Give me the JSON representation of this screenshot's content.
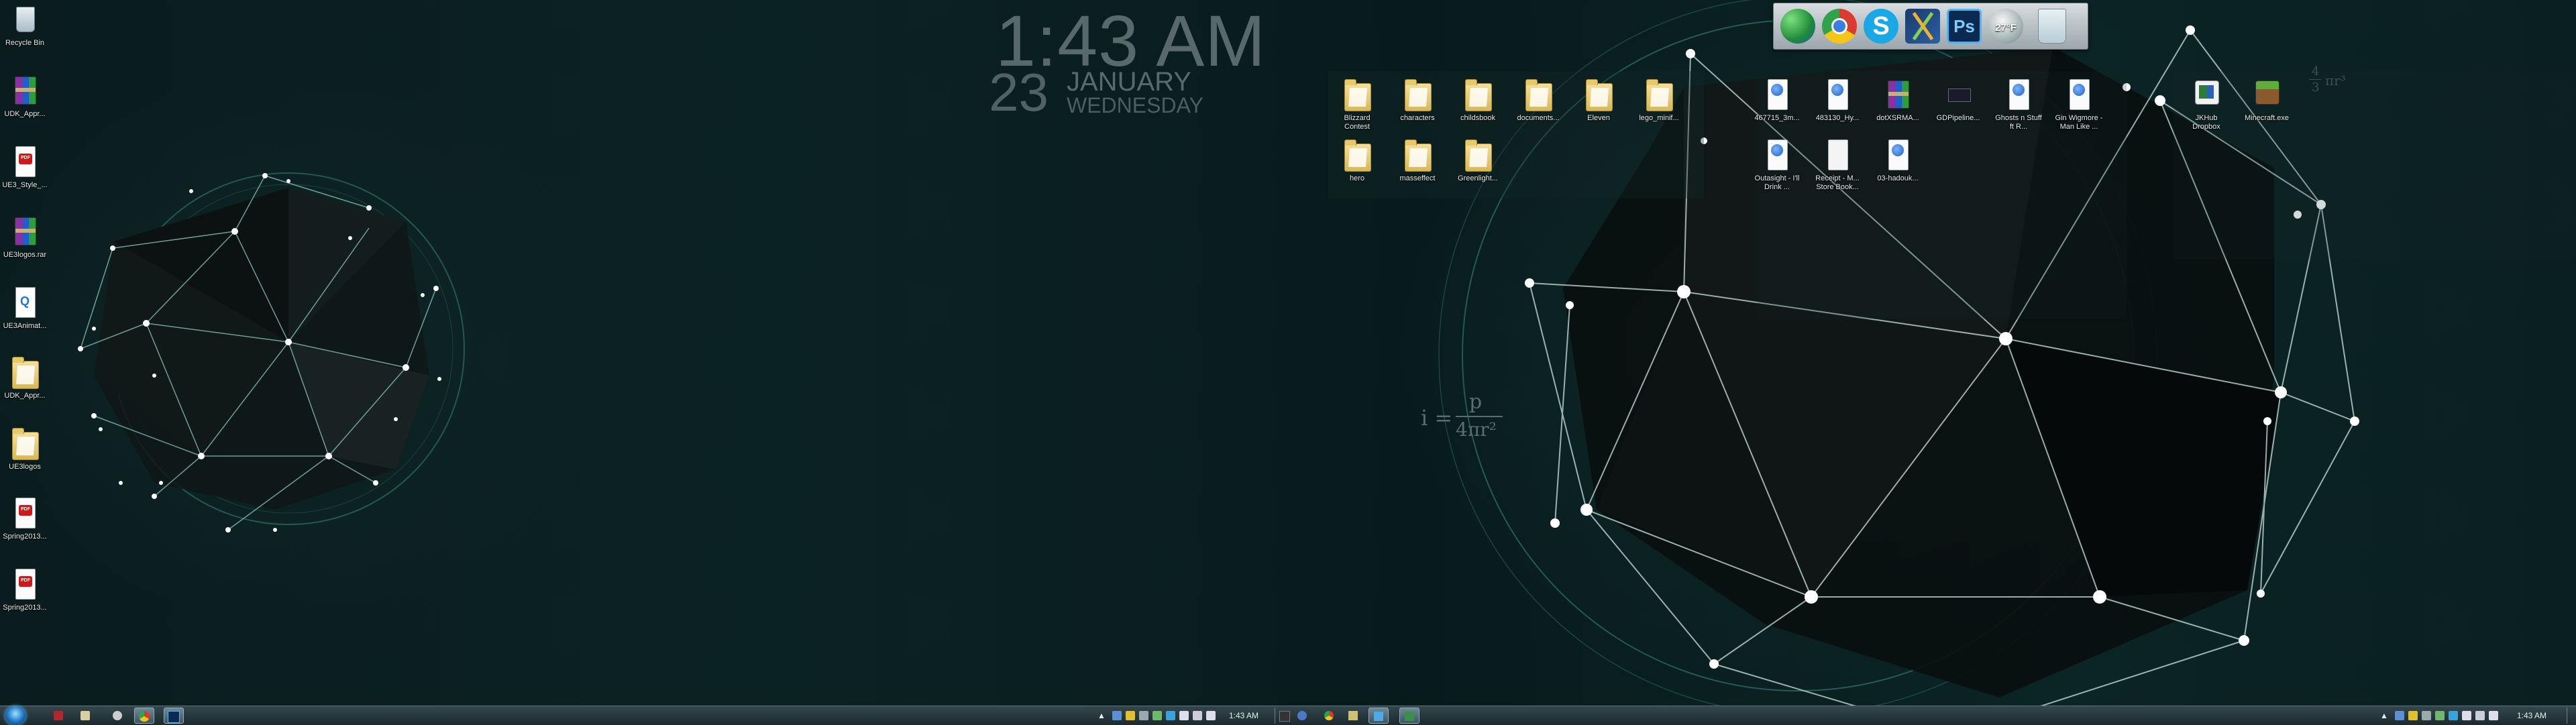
{
  "clock": {
    "time": "1:43 AM",
    "day": "23",
    "month": "JANUARY",
    "weekday": "WEDNESDAY"
  },
  "formula": {
    "lhs": "i =",
    "numerator": "p",
    "denominator": "4πr²"
  },
  "formula_small": {
    "lhs": "",
    "numerator": "4",
    "denominator": "3",
    "tail": "πr³"
  },
  "left_desktop_icons": [
    {
      "label": "Recycle Bin",
      "icon": "recycle-bin-icon"
    },
    {
      "label": "UDK_Appr...",
      "icon": "rar-archive-icon"
    },
    {
      "label": "UE3_Style_...",
      "icon": "pdf-icon"
    },
    {
      "label": "UE3logos.rar",
      "icon": "rar-archive-icon"
    },
    {
      "label": "UE3Animat...",
      "icon": "quicktime-file-icon"
    },
    {
      "label": "UDK_Appr...",
      "icon": "folder-icon"
    },
    {
      "label": "UE3logos",
      "icon": "folder-icon"
    },
    {
      "label": "Spring2013...",
      "icon": "pdf-icon"
    },
    {
      "label": "Spring2013...",
      "icon": "pdf-icon"
    }
  ],
  "right_desktop_icons": [
    {
      "label": "Blizzard Contest",
      "icon": "folder-icon"
    },
    {
      "label": "characters",
      "icon": "folder-icon"
    },
    {
      "label": "childsbook",
      "icon": "folder-icon"
    },
    {
      "label": "documents...",
      "icon": "folder-icon"
    },
    {
      "label": "Eleven",
      "icon": "folder-icon"
    },
    {
      "label": "lego_minif...",
      "icon": "folder-icon"
    },
    {
      "label": "467715_3m...",
      "icon": "web-document-icon"
    },
    {
      "label": "483130_Hy...",
      "icon": "web-document-icon"
    },
    {
      "label": "dotXSRMA...",
      "icon": "rar-archive-icon"
    },
    {
      "label": "GDPipeline...",
      "icon": "pipeline-image-icon"
    },
    {
      "label": "Ghosts n Stuff ft R...",
      "icon": "web-document-icon"
    },
    {
      "label": "Gin Wigmore - Man Like ...",
      "icon": "web-document-icon"
    },
    {
      "label": "JKHub Dropbox",
      "icon": "shortcut-app-icon"
    },
    {
      "label": "Minecraft.exe",
      "icon": "minecraft-icon"
    },
    {
      "label": "hero",
      "icon": "folder-icon"
    },
    {
      "label": "masseffect",
      "icon": "folder-icon"
    },
    {
      "label": "Greenlight...",
      "icon": "folder-icon"
    },
    {
      "label": "Outasight - I'll Drink ...",
      "icon": "web-document-icon"
    },
    {
      "label": "Receipt - M... Store Book...",
      "icon": "document-icon"
    },
    {
      "label": "03-hadouk...",
      "icon": "web-document-icon"
    }
  ],
  "dock": {
    "weather_temp": "27°F",
    "items": [
      "messenger-icon",
      "chrome-icon",
      "skype-icon",
      "xsi-icon",
      "photoshop-icon",
      "weather-icon",
      "recycle-bin-icon"
    ],
    "photoshop_label": "Ps"
  },
  "taskbar_left": {
    "buttons": [
      "start-orb",
      "taskbar-app-1",
      "taskbar-app-2",
      "taskbar-app-3",
      "taskbar-app-chrome",
      "taskbar-app-photoshop"
    ]
  },
  "tray_1": {
    "time": "1:43 AM"
  },
  "tray_2": {
    "time": "1:43 AM"
  },
  "colors": {
    "accent": "#3b8f8a",
    "background": "#0b2223",
    "text": "#e8eeee"
  }
}
